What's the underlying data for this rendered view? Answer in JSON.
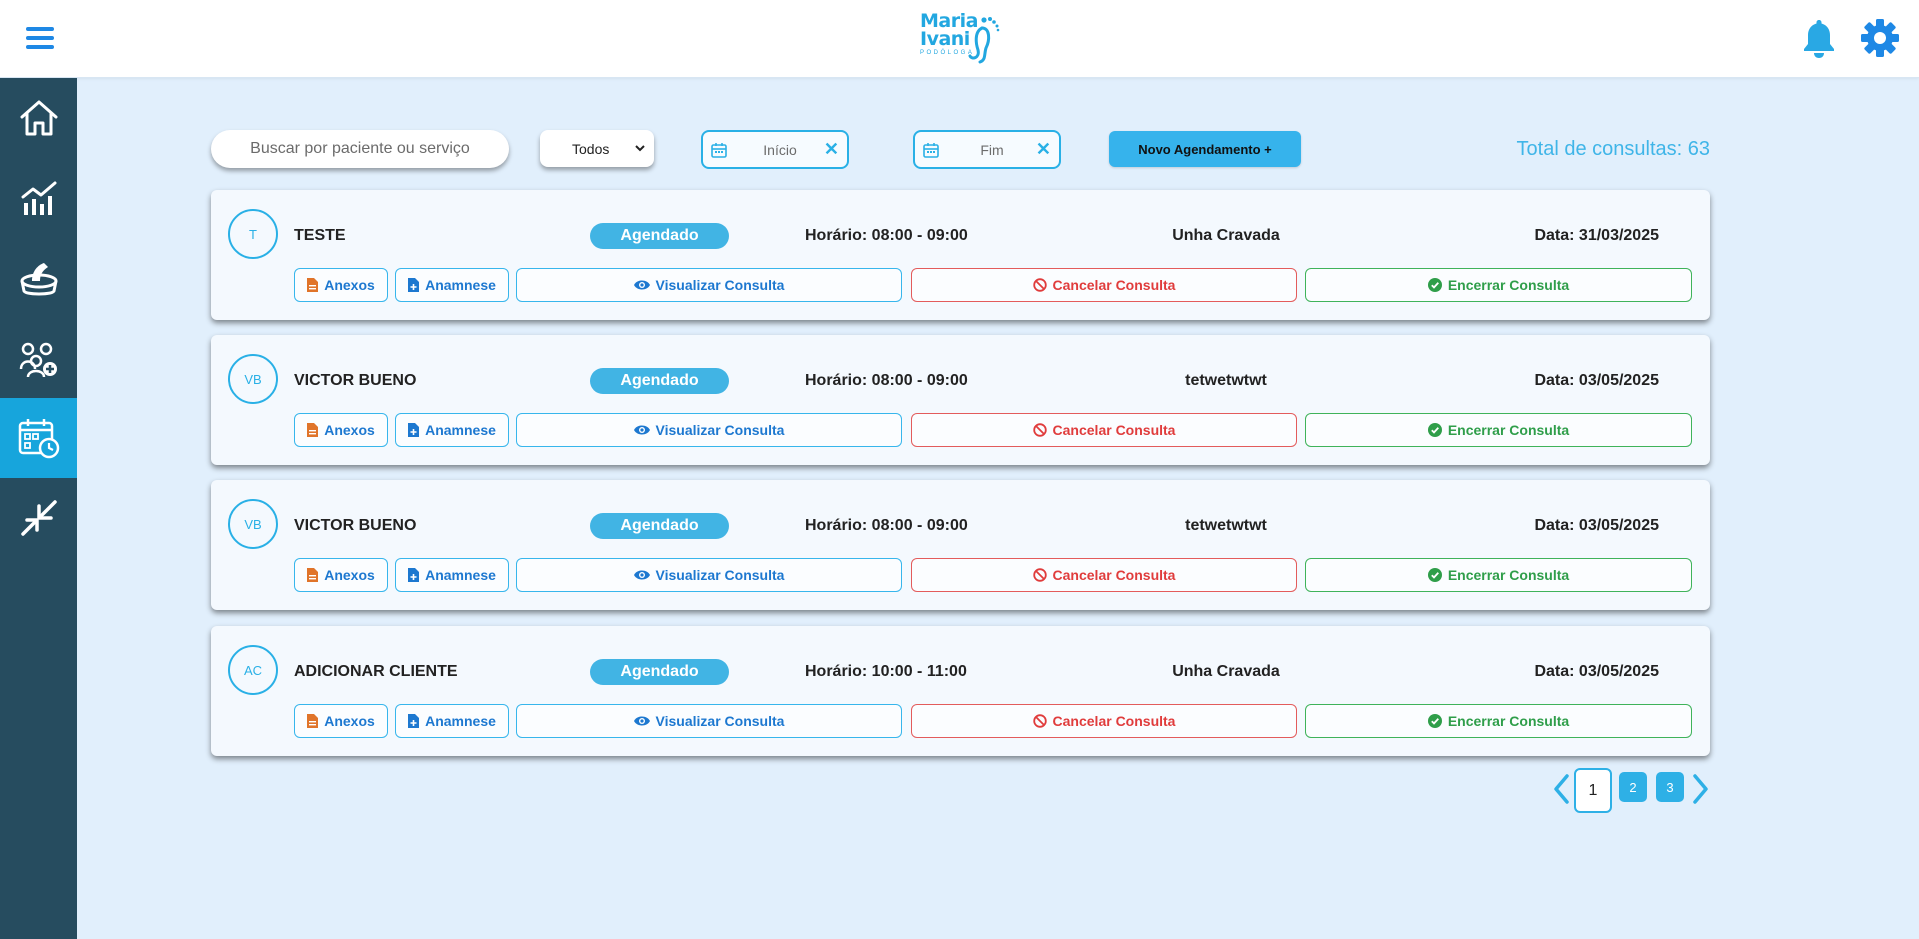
{
  "header": {
    "logo_line1": "Maria",
    "logo_line2": "Ivani",
    "logo_sub": "PODÓLOGA",
    "icons": [
      "menu-icon",
      "bell-icon",
      "gear-icon"
    ]
  },
  "sidebar": {
    "items": [
      {
        "icon": "home-icon"
      },
      {
        "icon": "chart-icon"
      },
      {
        "icon": "foot-basin-icon"
      },
      {
        "icon": "add-patients-icon"
      },
      {
        "icon": "calendar-clock-icon",
        "active": true
      },
      {
        "icon": "collapse-icon"
      }
    ]
  },
  "toolbar": {
    "search_placeholder": "Buscar por paciente ou serviço",
    "filter_value": "Todos",
    "start_placeholder": "Início",
    "end_placeholder": "Fim",
    "new_button": "Novo Agendamento +",
    "total_label": "Total de consultas: 63"
  },
  "appointments": [
    {
      "initials": "T",
      "name": "TESTE",
      "status": "Agendado",
      "time": "Horário: 08:00 - 09:00",
      "service": "Unha Cravada",
      "date": "Data: 31/03/2025"
    },
    {
      "initials": "VB",
      "name": "VICTOR BUENO",
      "status": "Agendado",
      "time": "Horário: 08:00 - 09:00",
      "service": "tetwetwtwt",
      "date": "Data: 03/05/2025"
    },
    {
      "initials": "VB",
      "name": "VICTOR BUENO",
      "status": "Agendado",
      "time": "Horário: 08:00 - 09:00",
      "service": "tetwetwtwt",
      "date": "Data: 03/05/2025"
    },
    {
      "initials": "AC",
      "name": "ADICIONAR CLIENTE",
      "status": "Agendado",
      "time": "Horário: 10:00 - 11:00",
      "service": "Unha Cravada",
      "date": "Data: 03/05/2025"
    }
  ],
  "actions": {
    "anexos": "Anexos",
    "anamnese": "Anamnese",
    "view": "Visualizar Consulta",
    "cancel": "Cancelar Consulta",
    "close": "Encerrar Consulta"
  },
  "pagination": {
    "current": "1",
    "pages": [
      "2",
      "3"
    ]
  },
  "colors": {
    "accent": "#29b0e6",
    "sidebar": "#264c5f",
    "background": "#e1effc",
    "cancel": "#e03c3c",
    "finish": "#2f9e4a"
  }
}
